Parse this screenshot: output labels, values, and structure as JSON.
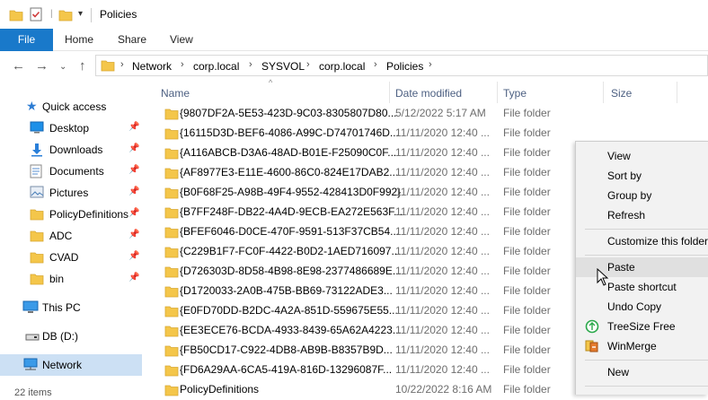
{
  "window": {
    "title": "Policies"
  },
  "ribbon": {
    "tabs": [
      "File",
      "Home",
      "Share",
      "View"
    ]
  },
  "address": {
    "crumbs": [
      "Network",
      "corp.local",
      "SYSVOL",
      "corp.local",
      "Policies"
    ]
  },
  "nav": {
    "quick_access": "Quick access",
    "items": [
      {
        "label": "Desktop",
        "icon": "desktop-icon",
        "pinned": true
      },
      {
        "label": "Downloads",
        "icon": "downloads-icon",
        "pinned": true
      },
      {
        "label": "Documents",
        "icon": "documents-icon",
        "pinned": true
      },
      {
        "label": "Pictures",
        "icon": "pictures-icon",
        "pinned": true
      },
      {
        "label": "PolicyDefinitions",
        "icon": "folder-icon",
        "pinned": true
      },
      {
        "label": "ADC",
        "icon": "folder-icon",
        "pinned": true
      },
      {
        "label": "CVAD",
        "icon": "folder-icon",
        "pinned": true
      },
      {
        "label": "bin",
        "icon": "folder-icon",
        "pinned": true
      }
    ],
    "this_pc": "This PC",
    "drive": "DB (D:)",
    "network": "Network"
  },
  "columns": {
    "name": "Name",
    "date": "Date modified",
    "type": "Type",
    "size": "Size"
  },
  "files": [
    {
      "name": "{9807DF2A-5E53-423D-9C03-8305807D80...",
      "date": "5/12/2022 5:17 AM",
      "type": "File folder"
    },
    {
      "name": "{16115D3D-BEF6-4086-A99C-D74701746D...",
      "date": "11/11/2020 12:40 ...",
      "type": "File folder"
    },
    {
      "name": "{A116ABCB-D3A6-48AD-B01E-F25090C0F...",
      "date": "11/11/2020 12:40 ...",
      "type": "File folder"
    },
    {
      "name": "{AF8977E3-E11E-4600-86C0-824E17DAB2...",
      "date": "11/11/2020 12:40 ...",
      "type": "File folder"
    },
    {
      "name": "{B0F68F25-A98B-49F4-9552-428413D0F992}",
      "date": "11/11/2020 12:40 ...",
      "type": "File folder"
    },
    {
      "name": "{B7FF248F-DB22-4A4D-9ECB-EA272E563F...",
      "date": "11/11/2020 12:40 ...",
      "type": "File folder"
    },
    {
      "name": "{BFEF6046-D0CE-470F-9591-513F37CB54...",
      "date": "11/11/2020 12:40 ...",
      "type": "File folder"
    },
    {
      "name": "{C229B1F7-FC0F-4422-B0D2-1AED716097...",
      "date": "11/11/2020 12:40 ...",
      "type": "File folder"
    },
    {
      "name": "{D726303D-8D58-4B98-8E98-2377486689E...",
      "date": "11/11/2020 12:40 ...",
      "type": "File folder"
    },
    {
      "name": "{D1720033-2A0B-475B-BB69-73122ADE3...",
      "date": "11/11/2020 12:40 ...",
      "type": "File folder"
    },
    {
      "name": "{E0FD70DD-B2DC-4A2A-851D-559675E55...",
      "date": "11/11/2020 12:40 ...",
      "type": "File folder"
    },
    {
      "name": "{EE3ECE76-BCDA-4933-8439-65A62A4223...",
      "date": "11/11/2020 12:40 ...",
      "type": "File folder"
    },
    {
      "name": "{FB50CD17-C922-4DB8-AB9B-B8357B9D...",
      "date": "11/11/2020 12:40 ...",
      "type": "File folder"
    },
    {
      "name": "{FD6A29AA-6CA5-419A-816D-13296087F...",
      "date": "11/11/2020 12:40 ...",
      "type": "File folder"
    },
    {
      "name": "PolicyDefinitions",
      "date": "10/22/2022 8:16 AM",
      "type": "File folder"
    }
  ],
  "context_menu": {
    "view": "View",
    "sort_by": "Sort by",
    "group_by": "Group by",
    "refresh": "Refresh",
    "customize": "Customize this folder",
    "paste": "Paste",
    "paste_shortcut": "Paste shortcut",
    "undo_copy": "Undo Copy",
    "treesize": "TreeSize Free",
    "winmerge": "WinMerge",
    "new": "New"
  },
  "status": {
    "count": "22 items"
  },
  "colors": {
    "accent": "#1979ca",
    "folder": "#f4c64a",
    "selection": "#cce0f4"
  }
}
